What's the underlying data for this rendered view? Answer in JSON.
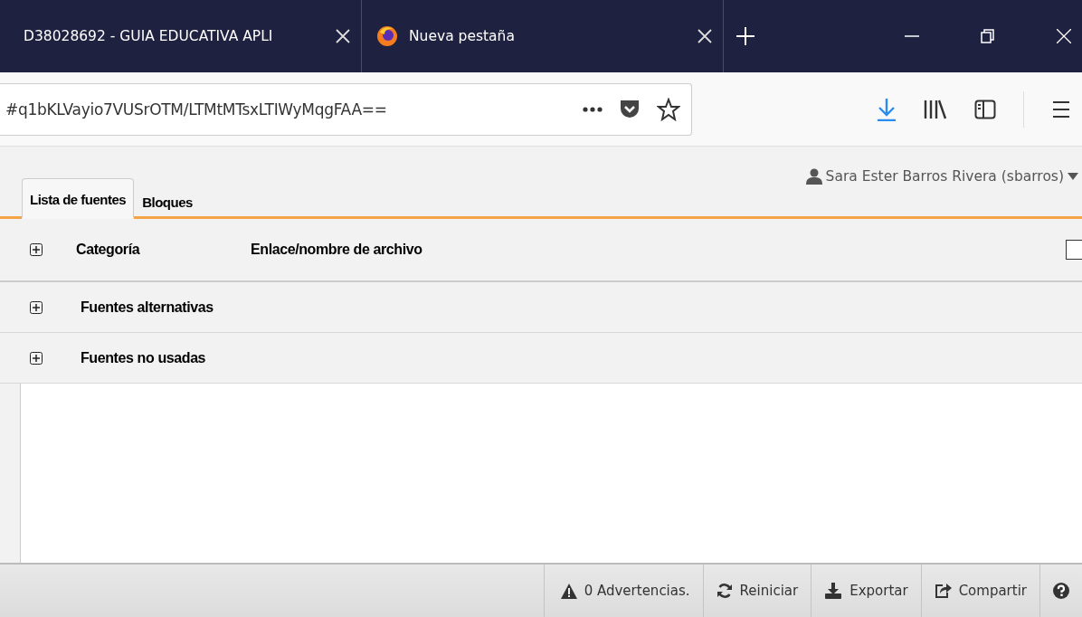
{
  "browser_tabs": [
    {
      "title": "D38028692 - GUIA EDUCATIVA APLI",
      "kind": "document"
    },
    {
      "title": "Nueva pestaña",
      "kind": "browser"
    }
  ],
  "address_bar": {
    "value": "#q1bKLVayio7VUSrOTM/LTMtMTsxLTIWyMqgFAA=="
  },
  "app_tabs": [
    {
      "label": "Lista de fuentes",
      "selected": true
    },
    {
      "label": "Bloques",
      "selected": false
    }
  ],
  "user": {
    "name": "Sara Ester Barros Rivera (sbarros)"
  },
  "table": {
    "columns": [
      "Categoría",
      "Enlace/nombre de archivo"
    ],
    "select_all_checked": false,
    "rows": [
      {
        "label": "Fuentes alternativas",
        "expanded": false
      },
      {
        "label": "Fuentes no usadas",
        "expanded": false
      }
    ]
  },
  "status_bar": {
    "buttons": [
      {
        "kind": "warning",
        "label": "0 Advertencias."
      },
      {
        "kind": "reset",
        "label": "Reiniciar"
      },
      {
        "kind": "export",
        "label": "Exportar"
      },
      {
        "kind": "share",
        "label": "Compartir"
      },
      {
        "kind": "help"
      }
    ]
  }
}
